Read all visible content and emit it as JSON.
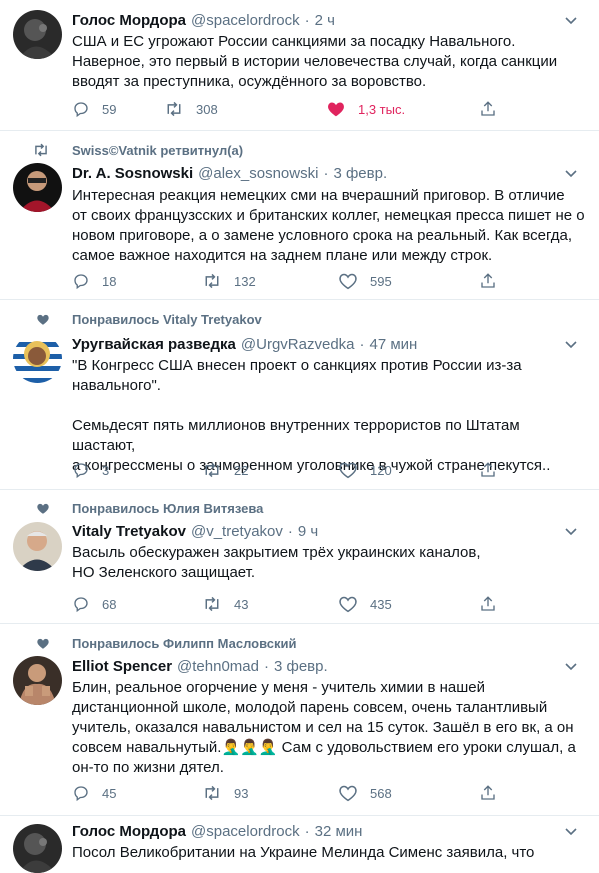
{
  "tweets": [
    {
      "context": "",
      "name": "Голос Мордора",
      "handle": "@spacelordrock",
      "dot": "·",
      "time": "2 ч",
      "text": "США и ЕС угрожают России санкциями за посадку Навального.\nНаверное, это первый в истории человечества случай, когда санкции\nвводят за преступника, осуждённого за воровство.",
      "replies": "59",
      "retweets": "308",
      "likes": "1,3 тыс."
    },
    {
      "context": "Swiss©Vatnik ретвитнул(а)",
      "name": "Dr. A. Sosnowski",
      "handle": "@alex_sosnowski",
      "dot": "·",
      "time": "3 февр.",
      "text": "Интересная реакция немецких сми на вчерашний приговор. В отличие\nот своих французсских и британских коллег, немецкая пресса пишет не о\nновом приговоре, а о замене условного срока на реальный. Как всегда,\nсамое важное находится на заднем плане или между строк.",
      "replies": "18",
      "retweets": "132",
      "likes": "595"
    },
    {
      "context": "Понравилось Vitaly Tretyakov",
      "name": "Уругвайская разведка",
      "handle": "@UrgvRazvedka",
      "dot": "·",
      "time": "47 мин",
      "text": "\"В Конгресс США внесен проект о санкциях против России из-за\nнавального\".\n\nСемьдесят пять миллионов внутренних террористов по Штатам шастают,\nа конгрессмены о зачморенном уголовнике в чужой стране пекутся..",
      "replies": "3",
      "retweets": "22",
      "likes": "120"
    },
    {
      "context": "Понравилось Юлия Витязева",
      "name": "Vitaly Tretyakov",
      "handle": "@v_tretyakov",
      "dot": "·",
      "time": "9 ч",
      "text": "Васыль обескуражен закрытием трёх украинских каналов,\nНО Зеленского защищает.",
      "replies": "68",
      "retweets": "43",
      "likes": "435"
    },
    {
      "context": "Понравилось Филипп Масловский",
      "name": "Elliot Spencer",
      "handle": "@tehn0mad",
      "dot": "·",
      "time": "3 февр.",
      "text": "Блин, реальное огорчение у меня - учитель химии в нашей\nдистанционной школе, молодой парень совсем, очень талантливый\nучитель, оказался навальнистом и сел на 15 суток. Зашёл в его вк, а он\nсовсем навальнутый.🤦‍♂️🤦‍♂️🤦‍♂️ Сам с удовольствием его уроки слушал, а\nон-то по жизни дятел.",
      "replies": "45",
      "retweets": "93",
      "likes": "568"
    },
    {
      "context": "",
      "name": "Голос Мордора",
      "handle": "@spacelordrock",
      "dot": "·",
      "time": "32 мин",
      "text": "Посол Великобритании на Украине Мелинда Сименс заявила, что",
      "replies": "",
      "retweets": "",
      "likes": ""
    }
  ],
  "colors": {
    "secondary": "#5b7083",
    "like_active": "#e0245e",
    "divider": "#e6ecf0"
  },
  "icons": [
    "caret-down-icon",
    "retweet-icon",
    "heart-icon",
    "reply-icon",
    "share-icon",
    "heart-filled-icon"
  ]
}
